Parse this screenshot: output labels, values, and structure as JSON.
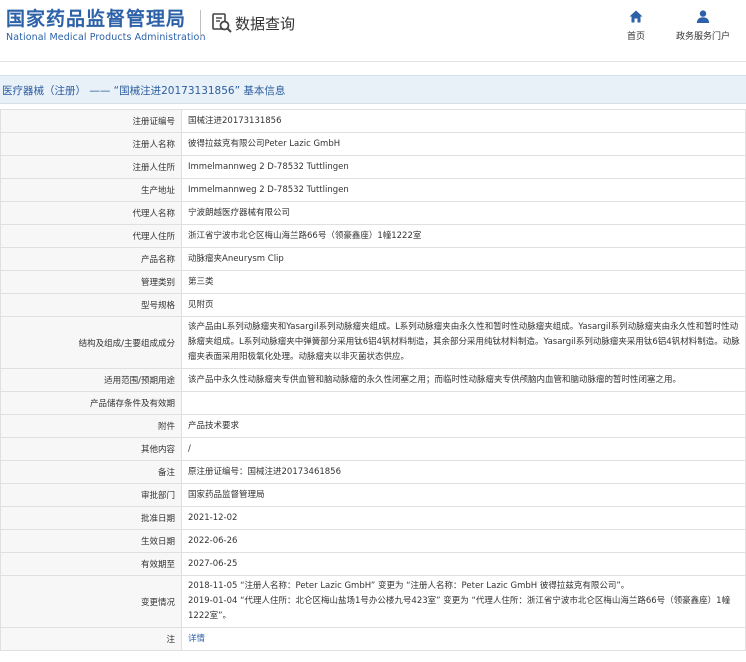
{
  "header": {
    "logo_cn": "国家药品监督管理局",
    "logo_en": "National Medical Products Administration",
    "section_title": "数据查询",
    "nav": [
      {
        "label": "首页",
        "icon": "home-icon"
      },
      {
        "label": "政务服务门户",
        "icon": "user-icon"
      }
    ]
  },
  "titlebar": {
    "text": "医疗器械（注册） —— “国械注进20173131856” 基本信息"
  },
  "rows": [
    {
      "label": "注册证编号",
      "value": "国械注进20173131856"
    },
    {
      "label": "注册人名称",
      "value": "彼得拉兹克有限公司Peter Lazic GmbH"
    },
    {
      "label": "注册人住所",
      "value": "Immelmannweg 2 D-78532 Tuttlingen"
    },
    {
      "label": "生产地址",
      "value": "Immelmannweg 2 D-78532 Tuttlingen"
    },
    {
      "label": "代理人名称",
      "value": "宁波朗越医疗器械有限公司"
    },
    {
      "label": "代理人住所",
      "value": "浙江省宁波市北仑区梅山海兰路66号（领豪鑫座）1幢1222室"
    },
    {
      "label": "产品名称",
      "value": "动脉瘤夹Aneurysm Clip"
    },
    {
      "label": "管理类别",
      "value": "第三类"
    },
    {
      "label": "型号规格",
      "value": "见附页"
    },
    {
      "label": "结构及组成/主要组成成分",
      "value": "该产品由L系列动脉瘤夹和Yasargil系列动脉瘤夹组成。L系列动脉瘤夹由永久性和暂时性动脉瘤夹组成。Yasargil系列动脉瘤夹由永久性和暂时性动脉瘤夹组成。L系列动脉瘤夹中弹簧部分采用钛6铝4钒材料制造，其余部分采用纯钛材料制造。Yasargil系列动脉瘤夹采用钛6铝4钒材料制造。动脉瘤夹表面采用阳极氧化处理。动脉瘤夹以非灭菌状态供应。"
    },
    {
      "label": "适用范围/预期用途",
      "value": "该产品中永久性动脉瘤夹专供血管和脑动脉瘤的永久性闭塞之用；而临时性动脉瘤夹专供颅脑内血管和脑动脉瘤的暂时性闭塞之用。"
    },
    {
      "label": "产品储存条件及有效期",
      "value": ""
    },
    {
      "label": "附件",
      "value": "产品技术要求"
    },
    {
      "label": "其他内容",
      "value": "/"
    },
    {
      "label": "备注",
      "value": "原注册证编号：国械注进20173461856"
    },
    {
      "label": "审批部门",
      "value": "国家药品监督管理局"
    },
    {
      "label": "批准日期",
      "value": "2021-12-02"
    },
    {
      "label": "生效日期",
      "value": "2022-06-26"
    },
    {
      "label": "有效期至",
      "value": "2027-06-25"
    }
  ],
  "changes": {
    "label": "变更情况",
    "lines": [
      "2018-11-05 “注册人名称：Peter Lazic GmbH” 变更为 “注册人名称：Peter Lazic GmbH 彼得拉兹克有限公司”。",
      "2019-01-04 “代理人住所：北仑区梅山盐场1号办公楼九号423室” 变更为 “代理人住所：浙江省宁波市北仑区梅山海兰路66号（领豪鑫座）1幢1222室”。"
    ]
  },
  "note_row": {
    "label": "注",
    "link": "详情"
  },
  "colors": {
    "brand_blue": "#2d62a8",
    "titlebar_bg": "#e8f0f8",
    "label_bg": "#f7f7f7"
  }
}
